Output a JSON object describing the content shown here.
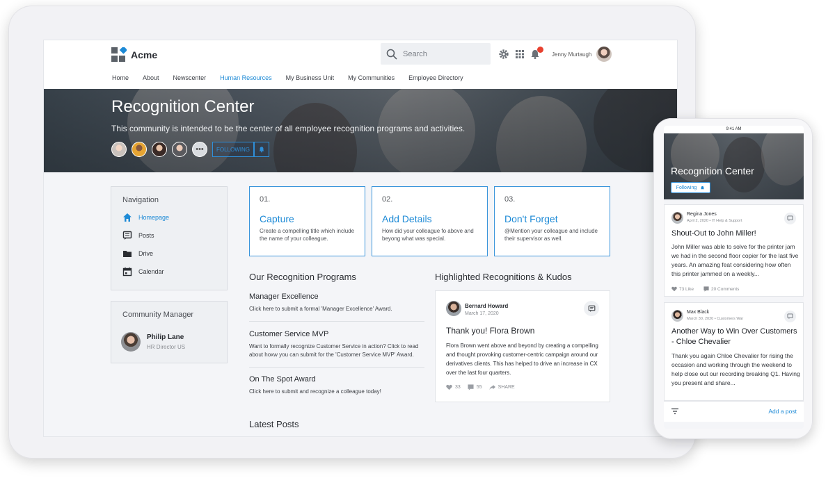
{
  "app": {
    "name": "Acme"
  },
  "search": {
    "placeholder": "Search"
  },
  "user": {
    "name": "Jenny Murtaugh"
  },
  "nav": [
    {
      "label": "Home",
      "active": false
    },
    {
      "label": "About",
      "active": false
    },
    {
      "label": "Newscenter",
      "active": false
    },
    {
      "label": "Human Resources",
      "active": true
    },
    {
      "label": "My Business Unit",
      "active": false
    },
    {
      "label": "My Communities",
      "active": false
    },
    {
      "label": "Employee Directory",
      "active": false
    }
  ],
  "hero": {
    "title": "Recognition Center",
    "subtitle": "This community is intended to be the center of all employee recognition programs and activities.",
    "follow_label": "FOLLOWING",
    "more_members": "•••"
  },
  "sidebar": {
    "title": "Navigation",
    "items": [
      {
        "label": "Homepage",
        "icon": "home-icon"
      },
      {
        "label": "Posts",
        "icon": "posts-icon"
      },
      {
        "label": "Drive",
        "icon": "folder-icon"
      },
      {
        "label": "Calendar",
        "icon": "calendar-icon"
      }
    ]
  },
  "community_manager": {
    "title": "Community Manager",
    "name": "Philip Lane",
    "role": "HR Director US"
  },
  "cards": [
    {
      "num": "01.",
      "title": "Capture",
      "desc": "Create a compelling title which include the name of your colleague."
    },
    {
      "num": "02.",
      "title": "Add Details",
      "desc": "How did your colleague fo above and beyong what was special."
    },
    {
      "num": "03.",
      "title": "Don't Forget",
      "desc": "@Mention your colleague and include their supervisor as well."
    }
  ],
  "programs": {
    "title": "Our Recognition Programs",
    "items": [
      {
        "title": "Manager Excellence",
        "desc": "Click here to submit a formal 'Manager Excellence' Award."
      },
      {
        "title": "Customer Service MVP",
        "desc": "Want to formally recognize Customer Service in action? Click to read about hoxw you can submit for the 'Customer Service MVP' Award."
      },
      {
        "title": "On The Spot Award",
        "desc": "Click here to submit and recognize a colleague today!"
      }
    ]
  },
  "latest_posts": {
    "title": "Latest Posts"
  },
  "kudos": {
    "title": "Highlighted Recognitions & Kudos",
    "author": "Bernard Howard",
    "date": "March 17, 2020",
    "post_title": "Thank you! Flora Brown",
    "body": "Flora Brown went above and beyond by creating a compelling and thought provoking customer-centric campaign around our derivatives clients. This has helped to drive an increase in CX over the last four quarters.",
    "likes": "33",
    "comments": "55",
    "share": "SHARE"
  },
  "phone": {
    "time": "9:41 AM",
    "hero_title": "Recognition Center",
    "follow_label": "Following",
    "posts": [
      {
        "author": "Regina Jones",
        "meta": "April 2, 2020 • IT Help & Support",
        "title": "Shout-Out to John Miller!",
        "body": "John Miller was able to solve for the printer jam we had in the second floor copier for the last five years. An amazing feat considering how often this printer jammed on a weekly...",
        "likes": "73 Like",
        "comments": "20 Comments"
      },
      {
        "author": "Max Black",
        "meta": "March 30, 2020 • Customers War",
        "title": "Another Way to Win Over Customers - Chloe Chevalier",
        "body": "Thank you again Chloe Chevalier for rising the occasion and working through the weekend to help close out our recording breaking Q1. Having you present and share..."
      }
    ],
    "add_post": "Add a post"
  },
  "colors": {
    "accent": "#1d8ad6",
    "notification": "#e8412f"
  }
}
